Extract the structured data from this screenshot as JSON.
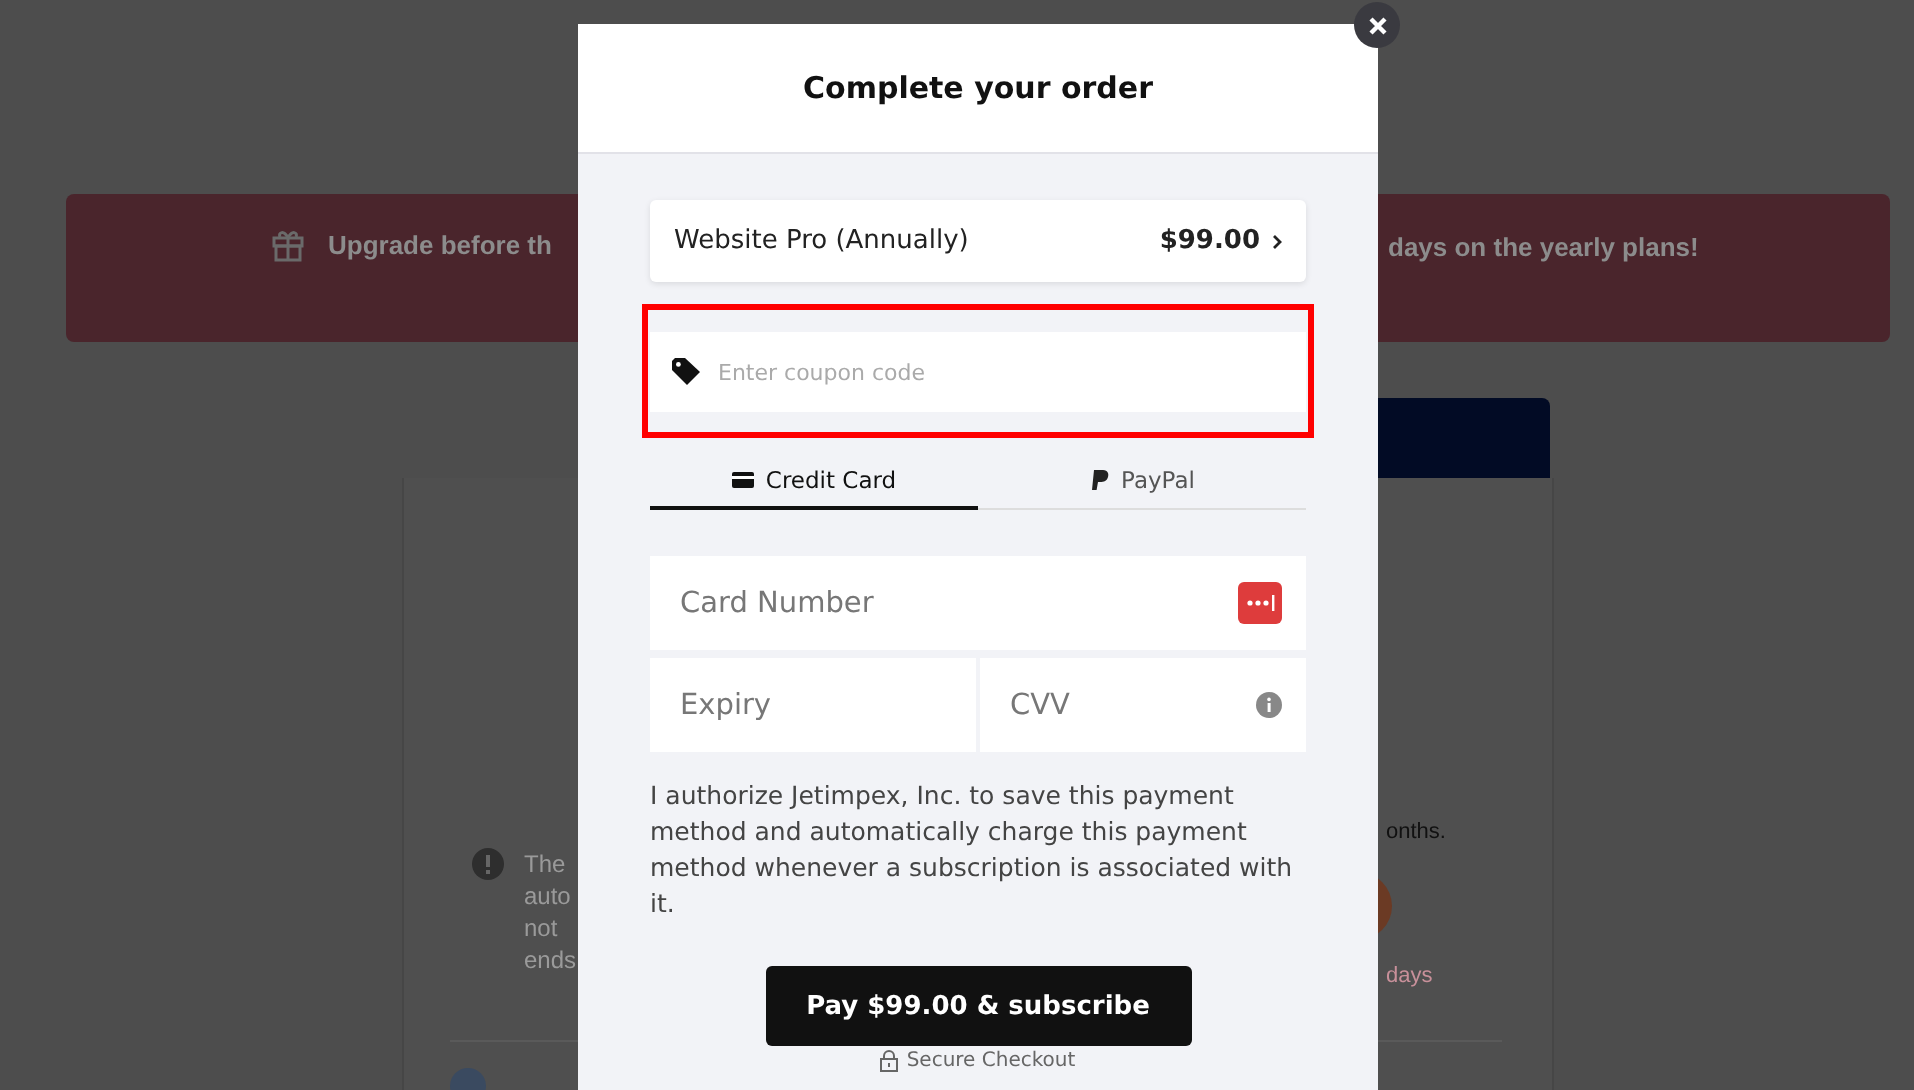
{
  "background": {
    "banner": {
      "text_left": "Upgrade before th",
      "text_right": "days on the yearly plans!"
    },
    "notice_lines": [
      "The",
      "auto",
      "not",
      "ends"
    ],
    "fragment_months": "onths.",
    "fragment_days": "days"
  },
  "modal": {
    "title": "Complete your order",
    "product": {
      "name": "Website Pro (Annually)",
      "price": "$99.00"
    },
    "coupon": {
      "placeholder": "Enter coupon code",
      "highlighted": true
    },
    "tabs": [
      {
        "label": "Credit Card",
        "kind": "card",
        "selected": true
      },
      {
        "label": "PayPal",
        "kind": "paypal",
        "selected": false
      }
    ],
    "card_number": {
      "placeholder": "Card Number"
    },
    "expiry": {
      "placeholder": "Expiry"
    },
    "cvv": {
      "placeholder": "CVV"
    },
    "authorization": "I authorize Jetimpex, Inc. to save this payment method and automatically charge this payment method whenever a subscription is associated with it.",
    "pay_button": "Pay $99.00 & subscribe",
    "secure_note": "Secure Checkout"
  }
}
